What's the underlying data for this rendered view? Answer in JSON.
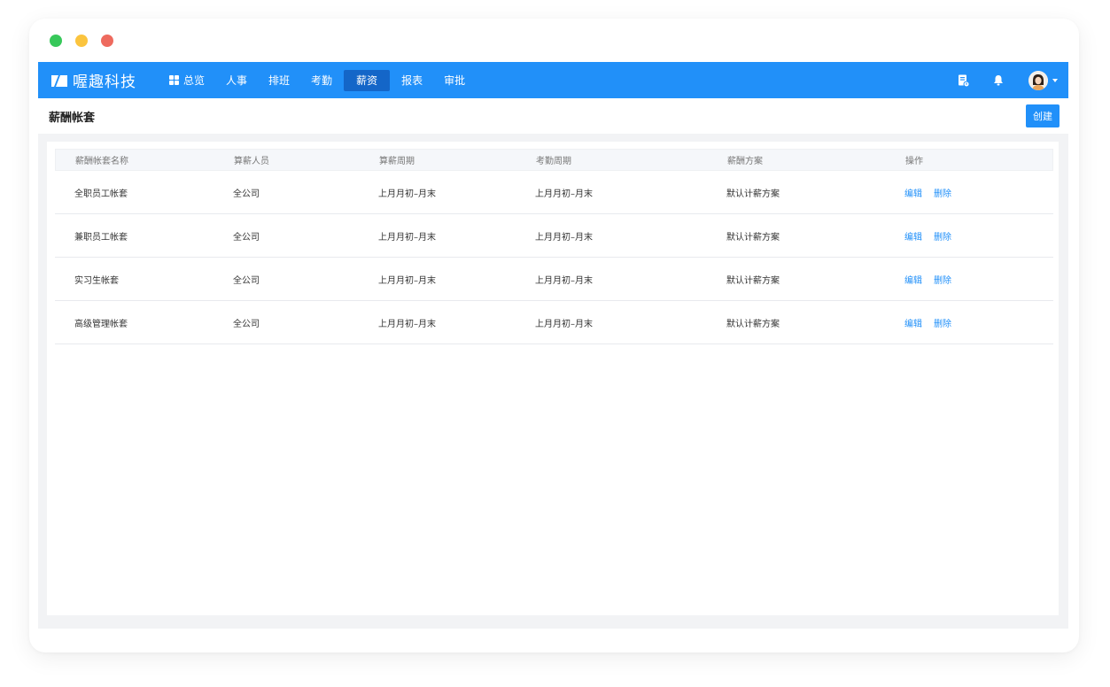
{
  "brand": {
    "name": "喔趣科技"
  },
  "nav": {
    "items": [
      {
        "label": "总览"
      },
      {
        "label": "人事"
      },
      {
        "label": "排班"
      },
      {
        "label": "考勤"
      },
      {
        "label": "薪资"
      },
      {
        "label": "报表"
      },
      {
        "label": "审批"
      }
    ],
    "active_index": 4
  },
  "page": {
    "title": "薪酬帐套",
    "create_label": "创建"
  },
  "table": {
    "columns": [
      "薪酬帐套名称",
      "算薪人员",
      "算薪周期",
      "考勤周期",
      "薪酬方案",
      "操作"
    ],
    "rows": [
      {
        "name": "全职员工帐套",
        "staff": "全公司",
        "pay_cycle": "上月月初–月末",
        "attendance_cycle": "上月月初–月末",
        "plan": "默认计薪方案",
        "edit": "编辑",
        "delete": "删除"
      },
      {
        "name": "兼职员工帐套",
        "staff": "全公司",
        "pay_cycle": "上月月初–月末",
        "attendance_cycle": "上月月初–月末",
        "plan": "默认计薪方案",
        "edit": "编辑",
        "delete": "删除"
      },
      {
        "name": "实习生帐套",
        "staff": "全公司",
        "pay_cycle": "上月月初–月末",
        "attendance_cycle": "上月月初–月末",
        "plan": "默认计薪方案",
        "edit": "编辑",
        "delete": "删除"
      },
      {
        "name": "高级管理帐套",
        "staff": "全公司",
        "pay_cycle": "上月月初–月末",
        "attendance_cycle": "上月月初–月末",
        "plan": "默认计薪方案",
        "edit": "编辑",
        "delete": "删除"
      }
    ]
  },
  "icons": {
    "brand": "logo-icon",
    "overview": "grid-icon",
    "doc": "document-icon",
    "bell": "bell-icon",
    "avatar": "avatar-icon",
    "caret": "chevron-down-icon"
  },
  "colors": {
    "primary": "#2190f9",
    "nav_active": "#1466c8",
    "link": "#2190f9"
  }
}
